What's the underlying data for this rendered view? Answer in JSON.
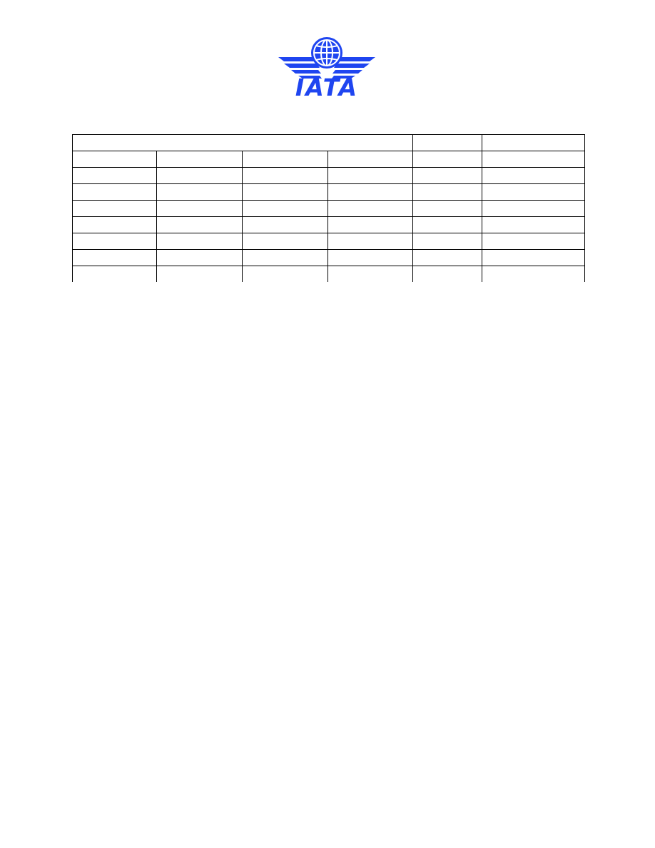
{
  "logo": {
    "text": "IATA",
    "icon": "globe-wings-icon",
    "color": "#1f45f0"
  },
  "table": {
    "header": [
      "",
      "",
      ""
    ],
    "rows": [
      [
        "",
        "",
        "",
        "",
        "",
        ""
      ],
      [
        "",
        "",
        "",
        "",
        "",
        ""
      ],
      [
        "",
        "",
        "",
        "",
        "",
        ""
      ],
      [
        "",
        "",
        "",
        "",
        "",
        ""
      ],
      [
        "",
        "",
        "",
        "",
        "",
        ""
      ],
      [
        "",
        "",
        "",
        "",
        "",
        ""
      ],
      [
        "",
        "",
        "",
        "",
        "",
        ""
      ],
      [
        "",
        "",
        "",
        "",
        "",
        ""
      ]
    ]
  }
}
